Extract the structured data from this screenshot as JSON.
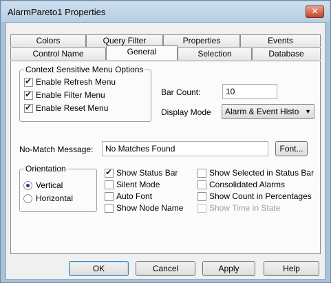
{
  "window": {
    "title": "AlarmPareto1 Properties",
    "close_glyph": "✕"
  },
  "tabs_row_back": [
    "Colors",
    "Query Filter",
    "Properties",
    "Events"
  ],
  "tabs_row_front": [
    "Control Name",
    "General",
    "Selection",
    "Database"
  ],
  "active_tab": "General",
  "context_menu_group": {
    "legend": "Context Sensitive Menu Options",
    "options": [
      {
        "label": "Enable Refresh Menu",
        "checked": true
      },
      {
        "label": "Enable Filter Menu",
        "checked": true
      },
      {
        "label": "Enable Reset Menu",
        "checked": true
      }
    ]
  },
  "bar_count": {
    "label": "Bar Count:",
    "value": "10"
  },
  "display_mode": {
    "label": "Display Mode",
    "value": "Alarm & Event Histo"
  },
  "no_match": {
    "label": "No-Match Message:",
    "value": "No Matches Found",
    "font_button": "Font..."
  },
  "orientation": {
    "legend": "Orientation",
    "options": [
      {
        "label": "Vertical",
        "checked": true
      },
      {
        "label": "Horizontal",
        "checked": false
      }
    ]
  },
  "options_col1": [
    {
      "label": "Show Status Bar",
      "checked": true,
      "disabled": false
    },
    {
      "label": "Silent Mode",
      "checked": false,
      "disabled": false
    },
    {
      "label": "Auto Font",
      "checked": false,
      "disabled": false
    },
    {
      "label": "Show Node Name",
      "checked": false,
      "disabled": false
    }
  ],
  "options_col2": [
    {
      "label": "Show Selected in Status Bar",
      "checked": false,
      "disabled": false
    },
    {
      "label": "Consolidated Alarms",
      "checked": false,
      "disabled": false
    },
    {
      "label": "Show Count in Percentages",
      "checked": false,
      "disabled": false
    },
    {
      "label": "Show Time in State",
      "checked": false,
      "disabled": true
    }
  ],
  "buttons": {
    "ok": "OK",
    "cancel": "Cancel",
    "apply": "Apply",
    "help": "Help"
  }
}
